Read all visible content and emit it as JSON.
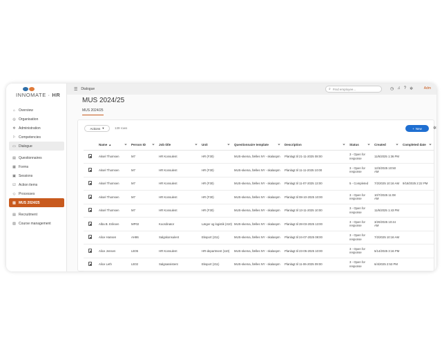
{
  "brand": {
    "logo_text_light": "INNOMATE",
    "logo_text_bold": "HR",
    "separator": "·",
    "colors": [
      "#2f6fa8",
      "#e07b3a"
    ]
  },
  "sidebar": {
    "items": [
      {
        "label": "Overview",
        "icon": "home-icon",
        "glyph": "⌂"
      },
      {
        "label": "Organisation",
        "icon": "org-icon",
        "glyph": "◎"
      },
      {
        "label": "Administration",
        "icon": "gear-icon",
        "glyph": "✲"
      },
      {
        "label": "Competencies",
        "icon": "badge-icon",
        "glyph": "⚐"
      },
      {
        "label": "Dialogue",
        "icon": "chat-icon",
        "glyph": "▭"
      },
      {
        "label": "Questionnaires",
        "icon": "questionnaire-icon",
        "glyph": "▤"
      },
      {
        "label": "Forms",
        "icon": "form-icon",
        "glyph": "▦"
      },
      {
        "label": "Sessions",
        "icon": "session-icon",
        "glyph": "▣"
      },
      {
        "label": "Action items",
        "icon": "checklist-icon",
        "glyph": "☑"
      },
      {
        "label": "Processes",
        "icon": "process-icon",
        "glyph": "◇"
      },
      {
        "label": "MUS 2024/25",
        "icon": "document-icon",
        "glyph": "▥"
      },
      {
        "label": "Recruitment",
        "icon": "recruitment-icon",
        "glyph": "▤"
      },
      {
        "label": "Course management",
        "icon": "course-icon",
        "glyph": "▧"
      }
    ]
  },
  "topbar": {
    "breadcrumb": "Dialogue",
    "search_placeholder": "Find employee...",
    "user": "Adm"
  },
  "page": {
    "title": "MUS 2024/25",
    "tab": "MUS 2024/25"
  },
  "toolbar": {
    "actions_label": "Actions",
    "rows_count": "139 rows",
    "new_label": "New"
  },
  "table": {
    "columns": [
      "",
      "Name",
      "Person ID",
      "Job title",
      "Unit",
      "Questionnaire template",
      "Description",
      "Status",
      "Created",
      "Completed date"
    ],
    "rows": [
      [
        "Aksel Thomsen",
        "M7",
        "HR Konsulent",
        "HR (F30)",
        "MUS-skema, fælles NY - skalaspm",
        "Planlagt til 21-11-2025 08:00",
        "3 - Open for response",
        "11/6/2025 1:36 PM",
        ""
      ],
      [
        "Aksel Thomsen",
        "M7",
        "HR Konsulent",
        "HR (F30)",
        "MUS-skema, fælles NY - skalaspm",
        "Planlagt til 11-11-2025 10:00",
        "3 - Open for response",
        "12/3/2025 10:50 AM",
        ""
      ],
      [
        "Aksel Thomsen",
        "M7",
        "HR Konsulent",
        "HR (F30)",
        "MUS-skema, fælles NY - skalaspm",
        "Planlagt til 11-07-2025 13:00",
        "5 - Completed",
        "7/2/2025 10:16 AM",
        "9/18/2025 2:22 PM"
      ],
      [
        "Aksel Thomsen",
        "M7",
        "HR Konsulent",
        "HR (F30)",
        "MUS-skema, fælles NY - skalaspm",
        "Planlagt til 08-10-2025 10:00",
        "3 - Open for response",
        "10/7/2025 11:08 AM",
        ""
      ],
      [
        "Aksel Thomsen",
        "M7",
        "HR Konsulent",
        "HR (F30)",
        "MUS-skema, fælles NY - skalaspm",
        "Planlagt til 13-11-2025 10:00",
        "3 - Open for response",
        "11/6/2025 1:43 PM",
        ""
      ],
      [
        "Alba B. Eriksen",
        "MP02",
        "Koordinator",
        "Læger og logistik (410)",
        "MUS-skema, fælles NY - skalaspm",
        "Planlagt til 28-03-2025 13:00",
        "3 - Open for response",
        "3/20/2025 10:44 AM",
        ""
      ],
      [
        "Alice Hansen",
        "AH86",
        "Salgskonsulent",
        "Eksport (211)",
        "MUS-skema, fælles NY - skalaspm",
        "Planlagt til 24-07-2025 08:00",
        "3 - Open for response",
        "7/2/2025 10:16 AM",
        ""
      ],
      [
        "Alice Jensen",
        "LE05",
        "HR Konsulent",
        "HR-department (110)",
        "MUS-skema, fælles NY - skalaspm",
        "Planlagt til 23-05-2025 10:00",
        "3 - Open for response",
        "5/14/2025 3:16 PM",
        ""
      ],
      [
        "Alice Leth",
        "LE02",
        "Salgsassistent",
        "Eksport (211)",
        "MUS-skema, fælles NY - skalaspm",
        "Planlagt til 11-06-2025 09:00",
        "3 - Open for response",
        "6/4/2025 2:53 PM",
        ""
      ]
    ]
  }
}
